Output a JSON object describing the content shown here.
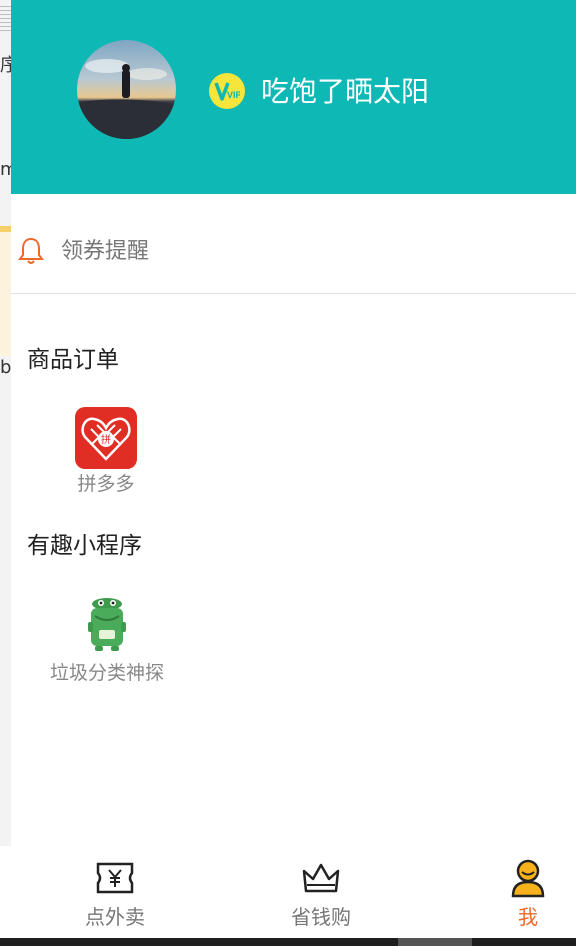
{
  "header": {
    "username": "吃饱了晒太阳",
    "badge_text": "VIP",
    "colors": {
      "background": "#0db8b5",
      "badge": "#f6e53a"
    }
  },
  "coupon_reminder": {
    "label": "领券提醒",
    "icon": "bell-icon",
    "color": "#ee6a2c"
  },
  "sections": [
    {
      "title": "商品订单",
      "apps": [
        {
          "name": "拼多多",
          "icon": "pinduoduo-icon",
          "icon_text": "拼"
        }
      ]
    },
    {
      "title": "有趣小程序",
      "apps": [
        {
          "name": "垃圾分类神探",
          "icon": "trash-can-icon"
        }
      ]
    }
  ],
  "tabbar": {
    "items": [
      {
        "label": "点外卖",
        "icon": "ticket-yen-icon",
        "active": false
      },
      {
        "label": "省钱购",
        "icon": "crown-icon",
        "active": false
      },
      {
        "label": "我",
        "icon": "user-icon",
        "active": true
      }
    ],
    "active_color": "#ee6a2c"
  },
  "underlay": {
    "fragments": [
      "序",
      "m",
      "b"
    ]
  }
}
